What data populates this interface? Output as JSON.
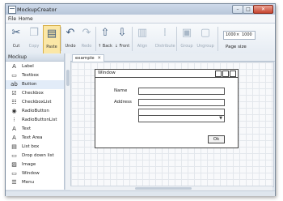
{
  "app": {
    "title": "MockupCreator"
  },
  "window_controls": {
    "minimize": "–",
    "maximize": "□",
    "close": "✕"
  },
  "menu": [
    "File",
    "Home"
  ],
  "ribbon": {
    "buttons": [
      {
        "label": "Cut",
        "icon": "scissors-icon",
        "glyph": "✂",
        "enabled": true
      },
      {
        "label": "Copy",
        "icon": "copy-icon",
        "glyph": "❐",
        "enabled": false
      },
      {
        "label": "Paste",
        "icon": "paste-icon",
        "glyph": "▤",
        "enabled": true,
        "selected": true
      },
      {
        "label": "Undo",
        "icon": "undo-icon",
        "glyph": "↶",
        "enabled": true
      },
      {
        "label": "Redo",
        "icon": "redo-icon",
        "glyph": "↷",
        "enabled": false
      },
      {
        "label": "↑ Back",
        "icon": "bring-up-icon",
        "glyph": "⇧",
        "enabled": true
      },
      {
        "label": "↓ Front",
        "icon": "send-down-icon",
        "glyph": "⇩",
        "enabled": true
      },
      {
        "label": "Align",
        "icon": "align-icon",
        "glyph": "▥",
        "enabled": false
      },
      {
        "label": "Distribute",
        "icon": "distribute-icon",
        "glyph": "⁞",
        "enabled": false
      },
      {
        "label": "Group",
        "icon": "group-icon",
        "glyph": "▣",
        "enabled": false
      },
      {
        "label": "Ungroup",
        "icon": "ungroup-icon",
        "glyph": "▢",
        "enabled": false
      }
    ],
    "page_size": {
      "label": "Page size",
      "width": "1000",
      "sep": "×",
      "height": "1000"
    }
  },
  "toolbox": {
    "header": "Mockup",
    "items": [
      {
        "label": "Label",
        "icon": "label-icon",
        "glyph": "A"
      },
      {
        "label": "Textbox",
        "icon": "textbox-icon",
        "glyph": "▭"
      },
      {
        "label": "Button",
        "icon": "button-icon",
        "glyph": "ab",
        "selected": true
      },
      {
        "label": "Checkbox",
        "icon": "checkbox-icon",
        "glyph": "☑"
      },
      {
        "label": "CheckboxList",
        "icon": "checkbox-list-icon",
        "glyph": "☷"
      },
      {
        "label": "RadioButton",
        "icon": "radio-icon",
        "glyph": "◉"
      },
      {
        "label": "RadioButtonList",
        "icon": "radio-list-icon",
        "glyph": "⁝"
      },
      {
        "label": "Text",
        "icon": "text-icon",
        "glyph": "A"
      },
      {
        "label": "Text Area",
        "icon": "text-area-icon",
        "glyph": "A"
      },
      {
        "label": "List box",
        "icon": "list-box-icon",
        "glyph": "▤"
      },
      {
        "label": "Drop down list",
        "icon": "dropdown-icon",
        "glyph": "▭"
      },
      {
        "label": "Image",
        "icon": "image-icon",
        "glyph": "▨"
      },
      {
        "label": "Window",
        "icon": "window-icon",
        "glyph": "▭"
      },
      {
        "label": "Menu",
        "icon": "menu-icon",
        "glyph": "☰"
      }
    ]
  },
  "document": {
    "tab": "example",
    "tab_close": "✕"
  },
  "mockup": {
    "title": "Window",
    "name_label": "Name",
    "address_label": "Address",
    "dropdown_arrow": "▼",
    "ok_label": "Ok"
  }
}
